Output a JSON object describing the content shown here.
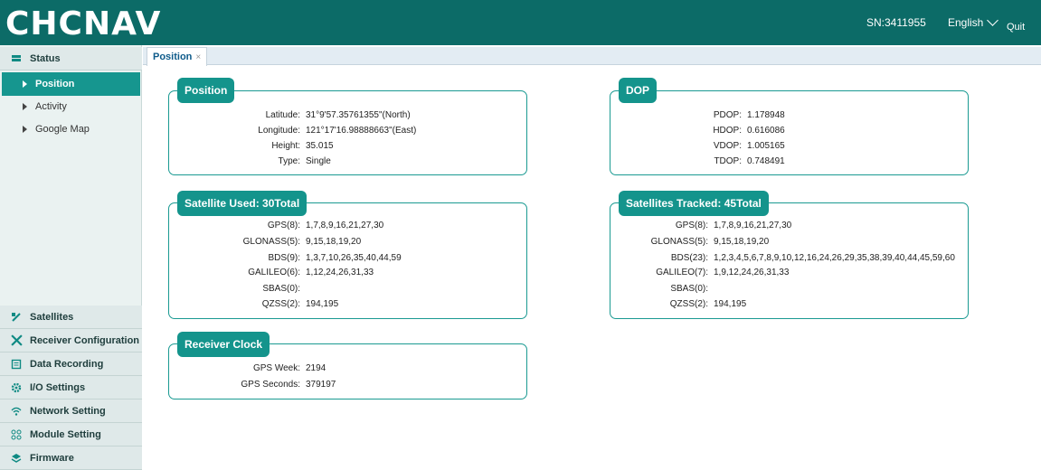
{
  "header": {
    "logo": "CHCNAV",
    "serial": "SN:3411955",
    "language": "English",
    "quit": "Quit"
  },
  "sidebar": {
    "status": "Status",
    "sub": [
      {
        "label": "Position"
      },
      {
        "label": "Activity"
      },
      {
        "label": "Google Map"
      }
    ],
    "groups": [
      {
        "label": "Satellites",
        "icon": "satellite-icon"
      },
      {
        "label": "Receiver Configuration",
        "icon": "tools-icon"
      },
      {
        "label": "Data Recording",
        "icon": "document-icon"
      },
      {
        "label": "I/O Settings",
        "icon": "gear-icon"
      },
      {
        "label": "Network Setting",
        "icon": "wifi-icon"
      },
      {
        "label": "Module Setting",
        "icon": "modules-icon"
      },
      {
        "label": "Firmware",
        "icon": "firmware-icon"
      }
    ]
  },
  "tab": {
    "label": "Position",
    "close": "×"
  },
  "position": {
    "title": "Position",
    "rows": [
      {
        "label": "Latitude:",
        "value": "31°9'57.35761355\"(North)"
      },
      {
        "label": "Longitude:",
        "value": "121°17'16.98888663\"(East)"
      },
      {
        "label": "Height:",
        "value": "35.015"
      },
      {
        "label": "Type:",
        "value": "Single"
      }
    ]
  },
  "dop": {
    "title": "DOP",
    "rows": [
      {
        "label": "PDOP:",
        "value": "1.178948"
      },
      {
        "label": "HDOP:",
        "value": "0.616086"
      },
      {
        "label": "VDOP:",
        "value": "1.005165"
      },
      {
        "label": "TDOP:",
        "value": "0.748491"
      }
    ]
  },
  "sat_used": {
    "title": "Satellite Used:  30Total",
    "rows": [
      {
        "label": "GPS(8):",
        "value": "1,7,8,9,16,21,27,30"
      },
      {
        "label": "GLONASS(5):",
        "value": "9,15,18,19,20"
      },
      {
        "label": "BDS(9):",
        "value": "1,3,7,10,26,35,40,44,59"
      },
      {
        "label": "GALILEO(6):",
        "value": "1,12,24,26,31,33"
      },
      {
        "label": "SBAS(0):",
        "value": ""
      },
      {
        "label": "QZSS(2):",
        "value": "194,195"
      }
    ]
  },
  "sat_tracked": {
    "title": "Satellites Tracked:  45Total",
    "rows": [
      {
        "label": "GPS(8):",
        "value": "1,7,8,9,16,21,27,30"
      },
      {
        "label": "GLONASS(5):",
        "value": "9,15,18,19,20"
      },
      {
        "label": "BDS(23):",
        "value": "1,2,3,4,5,6,7,8,9,10,12,16,24,26,29,35,38,39,40,44,45,59,60"
      },
      {
        "label": "GALILEO(7):",
        "value": "1,9,12,24,26,31,33"
      },
      {
        "label": "SBAS(0):",
        "value": ""
      },
      {
        "label": "QZSS(2):",
        "value": "194,195"
      }
    ]
  },
  "clock": {
    "title": "Receiver Clock",
    "rows": [
      {
        "label": "GPS Week:",
        "value": "2194"
      },
      {
        "label": "GPS Seconds:",
        "value": "379197"
      }
    ]
  }
}
